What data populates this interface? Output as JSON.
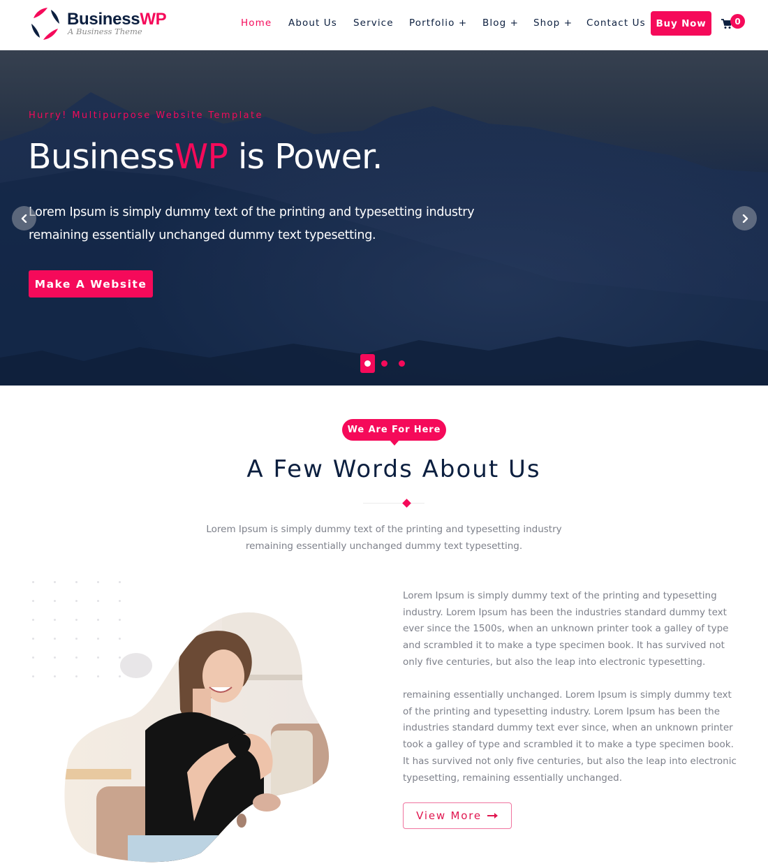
{
  "brand": {
    "name_main": "Business",
    "name_accent": "WP",
    "tagline": "A Business Theme",
    "accent_color": "#f50a5a",
    "navy_color": "#0c1f3f"
  },
  "nav": {
    "items": [
      {
        "label": "Home",
        "active": true
      },
      {
        "label": "About Us"
      },
      {
        "label": "Service"
      },
      {
        "label": "Portfolio +"
      },
      {
        "label": "Blog +"
      },
      {
        "label": "Shop +"
      },
      {
        "label": "Contact Us"
      }
    ],
    "buy_label": "Buy Now",
    "cart_icon": "shopping-cart-icon",
    "cart_count": "0"
  },
  "hero": {
    "kicker": "Hurry! Multipurpose Website Template",
    "title_main": "Business",
    "title_accent": "WP",
    "title_rest": " is Power.",
    "text": "Lorem Ipsum is simply dummy text of the printing and typesetting industry remaining essentially unchanged dummy text typesetting.",
    "cta_label": "Make A Website",
    "prev_icon": "chevron-left-icon",
    "next_icon": "chevron-right-icon",
    "slides_total": 3,
    "active_slide": 1
  },
  "about": {
    "pill": "We Are For Here",
    "title": "A Few Words About Us",
    "subtitle": "Lorem Ipsum is simply dummy text of the printing and typesetting industry remaining essentially unchanged dummy text typesetting.",
    "paragraph1": "Lorem Ipsum is simply dummy text of the printing and typesetting industry. Lorem Ipsum has been the industries standard dummy text ever since the 1500s, when an unknown printer took a galley of type and scrambled it to make a type specimen book. It has survived not only five centuries, but also the leap into electronic typesetting.",
    "paragraph2": "remaining essentially unchanged. Lorem Ipsum is simply dummy text of the printing and typesetting industry. Lorem Ipsum has been the industries standard dummy text ever since, when an unknown printer took a galley of type and scrambled it to make a type specimen book. It has survived not only five centuries, but also the leap into electronic typesetting, remaining essentially unchanged.",
    "button_label": "View More",
    "button_icon": "arrow-right-icon",
    "image_alt": "Smiling woman making heart shape with hands"
  }
}
